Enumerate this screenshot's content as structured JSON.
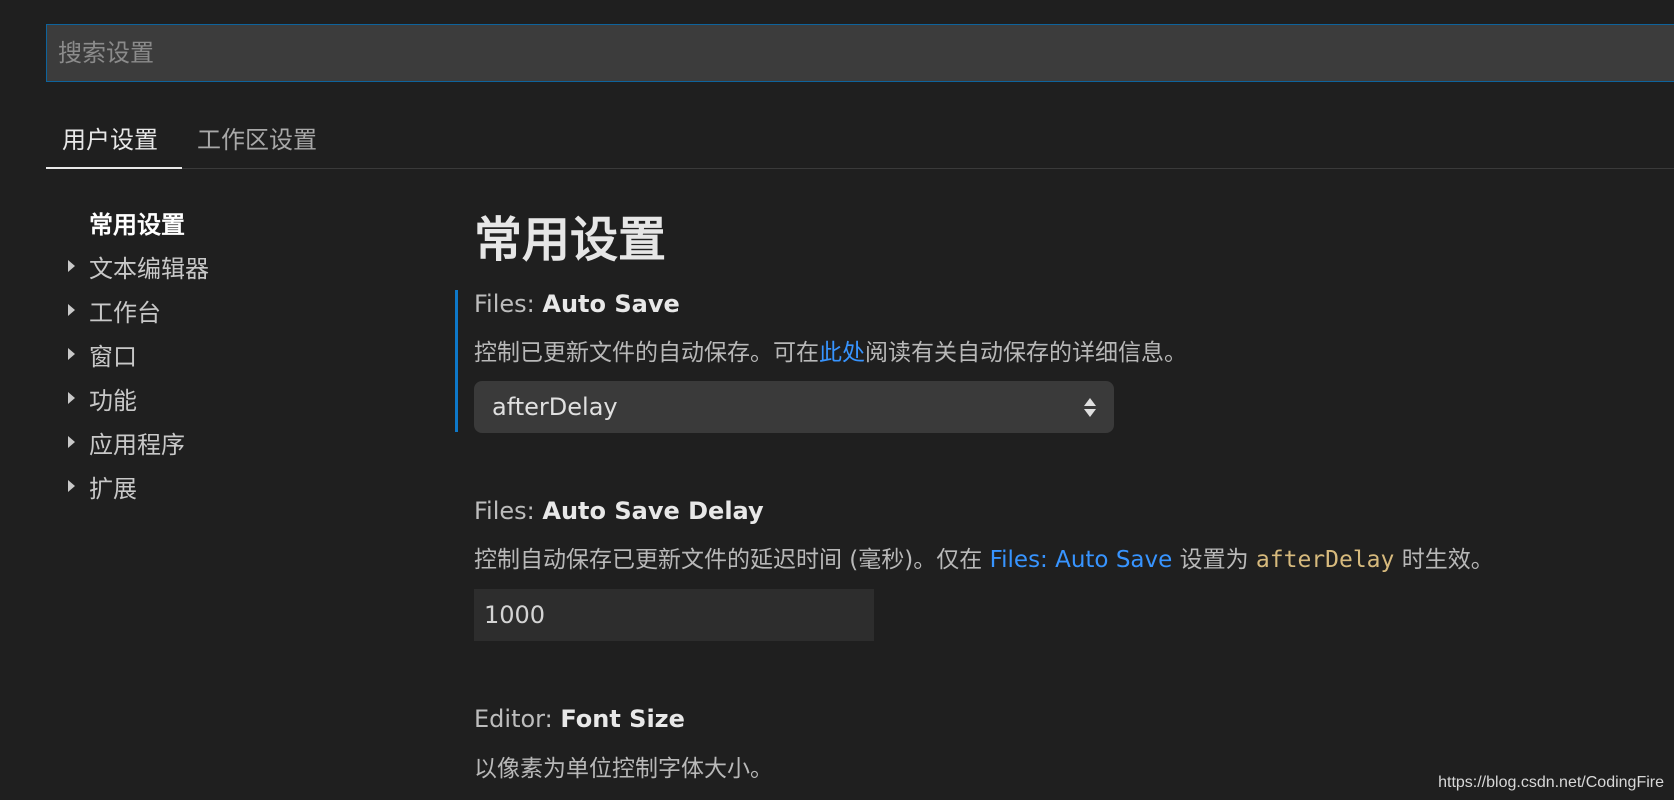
{
  "search": {
    "placeholder": "搜索设置"
  },
  "tabs": [
    {
      "label": "用户设置",
      "active": true
    },
    {
      "label": "工作区设置",
      "active": false
    }
  ],
  "toc": {
    "items": [
      {
        "label": "常用设置",
        "selected": true,
        "expandable": false
      },
      {
        "label": "文本编辑器",
        "selected": false,
        "expandable": true
      },
      {
        "label": "工作台",
        "selected": false,
        "expandable": true
      },
      {
        "label": "窗口",
        "selected": false,
        "expandable": true
      },
      {
        "label": "功能",
        "selected": false,
        "expandable": true
      },
      {
        "label": "应用程序",
        "selected": false,
        "expandable": true
      },
      {
        "label": "扩展",
        "selected": false,
        "expandable": true
      }
    ]
  },
  "main": {
    "section_title": "常用设置",
    "settings": [
      {
        "category": "Files: ",
        "name": "Auto Save",
        "desc_before": "控制已更新文件的自动保存。可在",
        "desc_link": "此处",
        "desc_after": "阅读有关自动保存的详细信息。",
        "value": "afterDelay"
      },
      {
        "category": "Files: ",
        "name": "Auto Save Delay",
        "desc_before": "控制自动保存已更新文件的延迟时间 (毫秒)。仅在 ",
        "desc_link": "Files: Auto Save",
        "desc_middle": " 设置为 ",
        "desc_code": "afterDelay",
        "desc_after": " 时生效。",
        "value": "1000"
      },
      {
        "category": "Editor: ",
        "name": "Font Size",
        "desc": "以像素为单位控制字体大小。"
      }
    ]
  },
  "watermark": "https://blog.csdn.net/CodingFire",
  "colors": {
    "background": "#1f1f1f",
    "accent": "#0e78c8",
    "link": "#3794ff",
    "code": "#d7ba7d"
  }
}
